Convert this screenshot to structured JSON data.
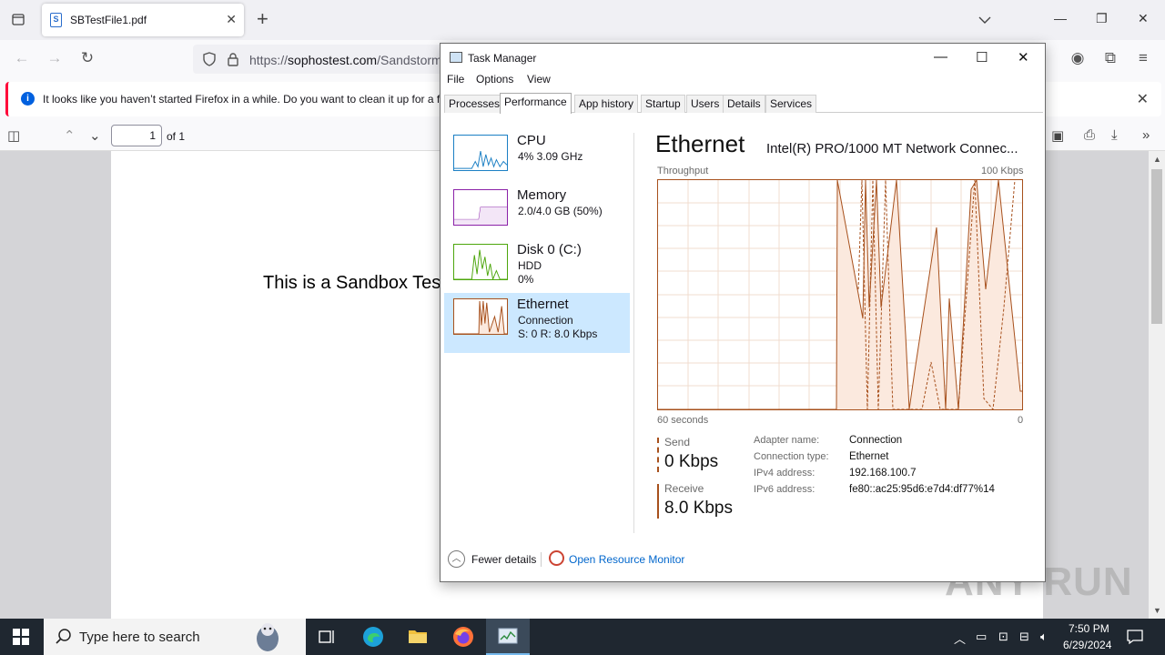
{
  "browser": {
    "tab_title": "SBTestFile1.pdf",
    "url_host": "sophostest.com",
    "url_prefix": "https://",
    "url_path": "/Sandstorm",
    "notice": "It looks like you haven’t started Firefox in a while. Do you want to clean it up for a fr",
    "page_number": "1",
    "page_of": "of 1",
    "pdf_text": "This is a Sandbox Tes"
  },
  "task_manager": {
    "title": "Task Manager",
    "menu": [
      "File",
      "Options",
      "View"
    ],
    "tabs": [
      "Processes",
      "Performance",
      "App history",
      "Startup",
      "Users",
      "Details",
      "Services"
    ],
    "active_tab": "Performance",
    "resources": [
      {
        "name": "CPU",
        "line1": "4% 3.09 GHz",
        "line2": "",
        "color": "#1b7fc4"
      },
      {
        "name": "Memory",
        "line1": "2.0/4.0 GB (50%)",
        "line2": "",
        "color": "#8b22a8"
      },
      {
        "name": "Disk 0 (C:)",
        "line1": "HDD",
        "line2": "0%",
        "color": "#4da60c"
      },
      {
        "name": "Ethernet",
        "line1": "Connection",
        "line2": "S: 0 R: 8.0 Kbps",
        "color": "#a7501c"
      }
    ],
    "detail": {
      "title": "Ethernet",
      "adapter": "Intel(R) PRO/1000 MT Network Connec...",
      "throughput_label": "Throughput",
      "max_label": "100 Kbps",
      "time_label": "60 seconds",
      "zero_label": "0",
      "send_label": "Send",
      "send_value": "0 Kbps",
      "receive_label": "Receive",
      "receive_value": "8.0 Kbps",
      "props": [
        {
          "key": "Adapter name:",
          "value": "Connection"
        },
        {
          "key": "Connection type:",
          "value": "Ethernet"
        },
        {
          "key": "IPv4 address:",
          "value": "192.168.100.7"
        },
        {
          "key": "IPv6 address:",
          "value": "fe80::ac25:95d6:e7d4:df77%14"
        }
      ]
    },
    "footer": {
      "fewer": "Fewer details",
      "monitor": "Open Resource Monitor"
    }
  },
  "taskbar": {
    "search_placeholder": "Type here to search",
    "time": "7:50 PM",
    "date": "6/29/2024"
  },
  "watermark": "ANY RUN"
}
